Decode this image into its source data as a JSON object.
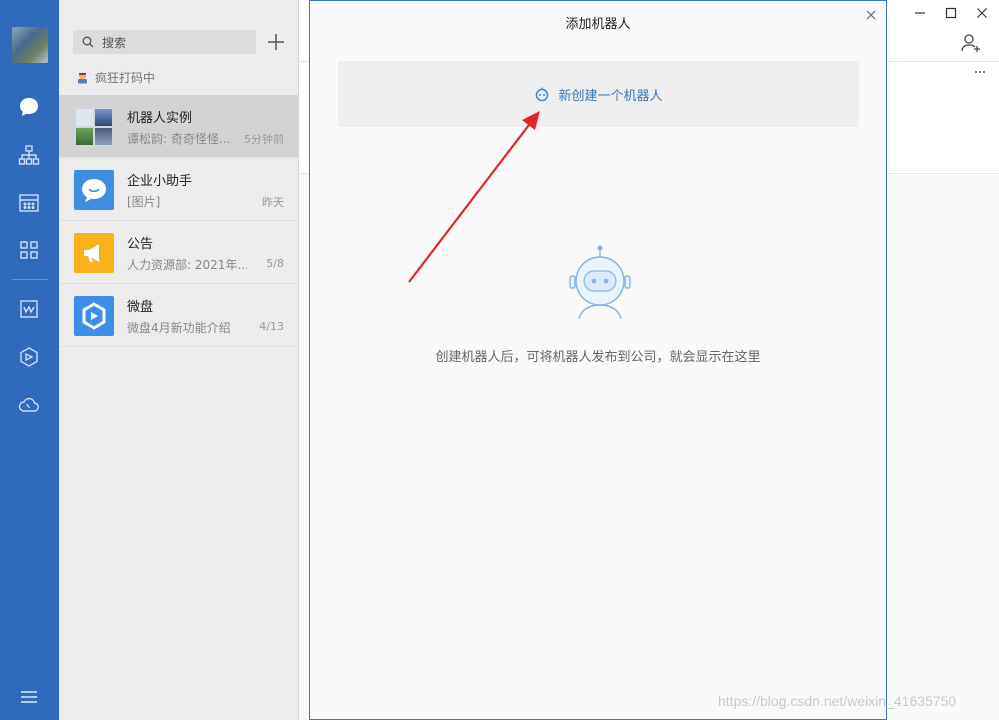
{
  "search": {
    "label": "搜索"
  },
  "status": {
    "label": "疯狂打码中"
  },
  "chats": [
    {
      "name": "机器人实例",
      "preview": "谭松韵: 奇奇怪怪...",
      "time": "5分钟前"
    },
    {
      "name": "企业小助手",
      "preview": "[图片]",
      "time": "昨天"
    },
    {
      "name": "公告",
      "preview": "人力资源部: 2021年...",
      "time": "5/8"
    },
    {
      "name": "微盘",
      "preview": "微盘4月新功能介绍",
      "time": "4/13"
    }
  ],
  "dialog": {
    "title": "添加机器人",
    "create_label": "新创建一个机器人",
    "empty_text": "创建机器人后，可将机器人发布到公司，就会显示在这里"
  },
  "watermark": "https://blog.csdn.net/weixin_41635750",
  "colors": {
    "rail": "#2f6bbd",
    "accent": "#3f74b8",
    "arrow": "#e0262b",
    "announce": "#f7b21d"
  }
}
